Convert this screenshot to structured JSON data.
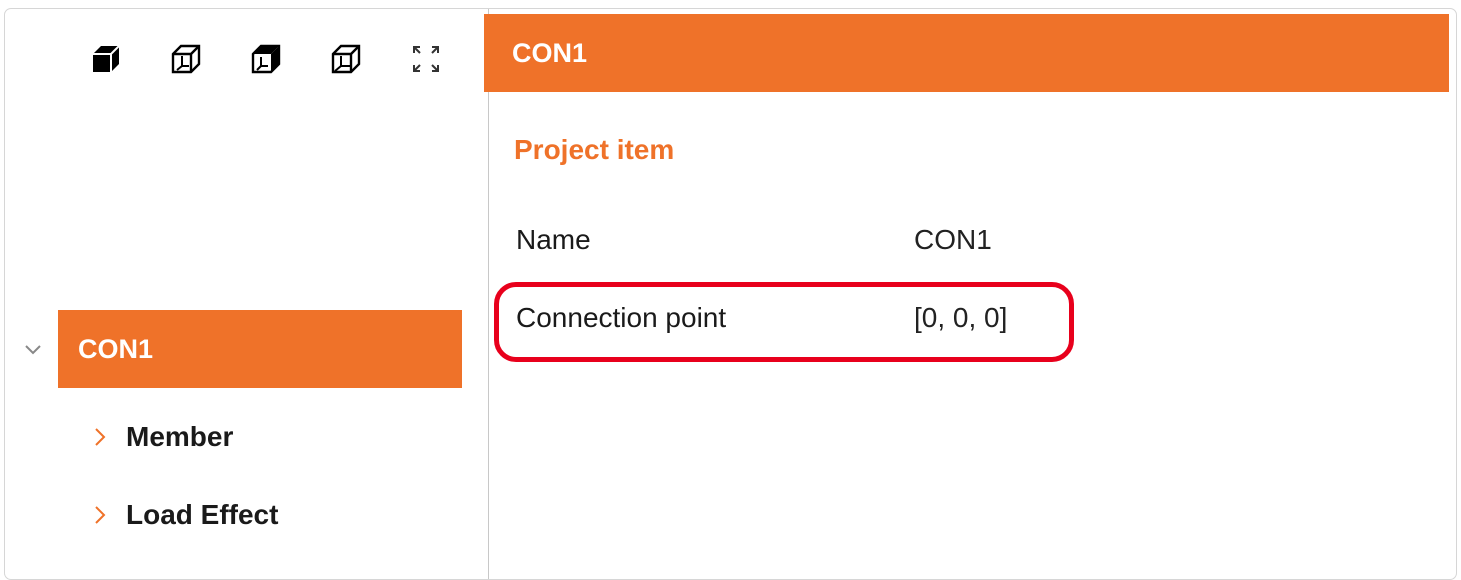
{
  "toolbar": {
    "icons": [
      "solid-cube-icon",
      "wireframe-cube-icon",
      "shaded-cube-icon",
      "outline-cube-icon",
      "fullscreen-icon"
    ]
  },
  "tree": {
    "root_label": "CON1",
    "children": [
      {
        "label": "Member"
      },
      {
        "label": "Load Effect"
      }
    ]
  },
  "detail": {
    "header_title": "CON1",
    "section_title": "Project item",
    "properties": [
      {
        "label": "Name",
        "value": "CON1"
      },
      {
        "label": "Connection point",
        "value": "[0, 0, 0]"
      }
    ]
  },
  "colors": {
    "accent": "#ef7229",
    "highlight": "#e8001c"
  }
}
